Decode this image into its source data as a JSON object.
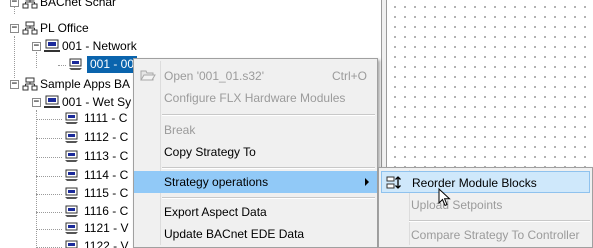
{
  "tree": {
    "items": [
      {
        "label": "BACnet Schar"
      },
      {
        "label": "PL Office"
      },
      {
        "label": "001 - Network"
      },
      {
        "label": "001 - 00"
      },
      {
        "label": "Sample Apps BA"
      },
      {
        "label": "001 - Wet Sy"
      },
      {
        "label": "1111 - C"
      },
      {
        "label": "1112 - C"
      },
      {
        "label": "1113 - C"
      },
      {
        "label": "1114 - C"
      },
      {
        "label": "1115 - C"
      },
      {
        "label": "1116 - C"
      },
      {
        "label": "1121 - V"
      },
      {
        "label": "1122 - V"
      }
    ]
  },
  "context_menu": {
    "items": [
      {
        "label": "Open '001_01.s32'",
        "shortcut": "Ctrl+O",
        "disabled": true
      },
      {
        "label": "Configure FLX Hardware Modules",
        "disabled": true
      },
      {
        "label": "Break",
        "disabled": true
      },
      {
        "label": "Copy Strategy To",
        "disabled": false
      },
      {
        "label": "Strategy operations",
        "disabled": false,
        "has_submenu": true
      },
      {
        "label": "Export Aspect Data",
        "disabled": false
      },
      {
        "label": "Update BACnet EDE Data",
        "disabled": false
      }
    ]
  },
  "submenu": {
    "items": [
      {
        "label": "Reorder Module Blocks",
        "disabled": false
      },
      {
        "label": "Upload Setpoints",
        "disabled": true
      },
      {
        "label": "Compare Strategy To Controller",
        "disabled": true
      }
    ]
  },
  "icons": {
    "network": "network-computer-icon",
    "controller": "controller-icon",
    "folder": "open-folder-icon",
    "reorder": "reorder-blocks-icon",
    "cursor": "mouse-pointer-icon"
  },
  "colors": {
    "selection": "#0a64ad",
    "menu_bg": "#f0f0f0",
    "menu_highlight": "#91c9f7",
    "submenu_highlight": "#cfe8fb"
  }
}
